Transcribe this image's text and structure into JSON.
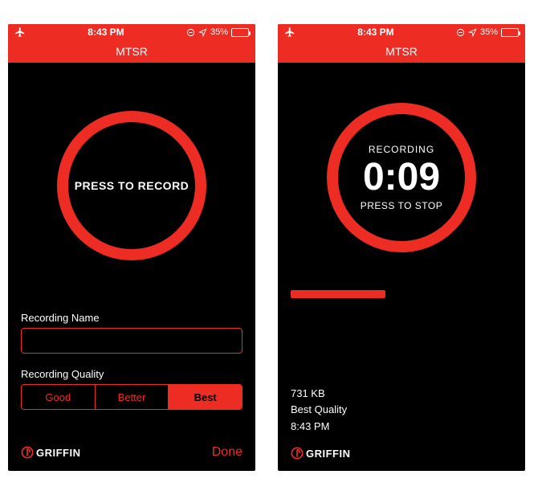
{
  "colors": {
    "accent": "#ed2d24",
    "bg": "#000000",
    "text": "#ffffff"
  },
  "status": {
    "time": "8:43 PM",
    "battery_pct": "35%"
  },
  "nav": {
    "title": "MTSR"
  },
  "left": {
    "record_button_label": "PRESS TO RECORD",
    "name_label": "Recording Name",
    "name_value": "",
    "quality_label": "Recording Quality",
    "quality_options": [
      "Good",
      "Better",
      "Best"
    ],
    "quality_selected": "Best",
    "done_label": "Done"
  },
  "right": {
    "recording_label": "RECORDING",
    "elapsed": "0:09",
    "stop_label": "PRESS TO STOP",
    "file_size": "731 KB",
    "file_quality": "Best Quality",
    "file_time": "8:43 PM"
  },
  "brand": {
    "name": "GRIFFIN"
  }
}
